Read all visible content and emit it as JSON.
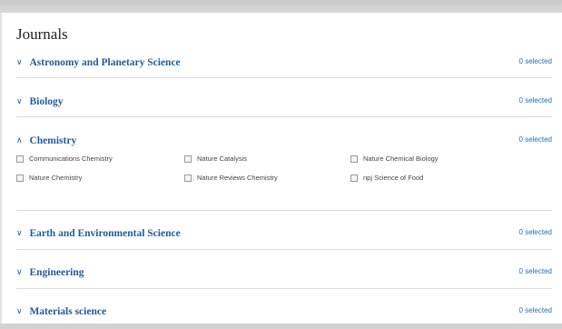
{
  "title": "Journals",
  "sections": [
    {
      "label": "Astronomy and Planetary Science",
      "count": "0 selected",
      "expanded": false
    },
    {
      "label": "Biology",
      "count": "0 selected",
      "expanded": false
    },
    {
      "label": "Chemistry",
      "count": "0 selected",
      "expanded": true,
      "journals": [
        "Communications Chemistry",
        "Nature Catalysis",
        "Nature Chemical Biology",
        "Nature Chemistry",
        "Nature Reviews Chemistry",
        "npj Science of Food"
      ]
    },
    {
      "label": "Earth and Environmental Science",
      "count": "0 selected",
      "expanded": false
    },
    {
      "label": "Engineering",
      "count": "0 selected",
      "expanded": false
    },
    {
      "label": "Materials science",
      "count": "0 selected",
      "expanded": false
    }
  ],
  "icons": {
    "collapsed": "chevron-down-icon",
    "expanded": "chevron-up-icon",
    "checkbox": "checkbox-icon"
  }
}
